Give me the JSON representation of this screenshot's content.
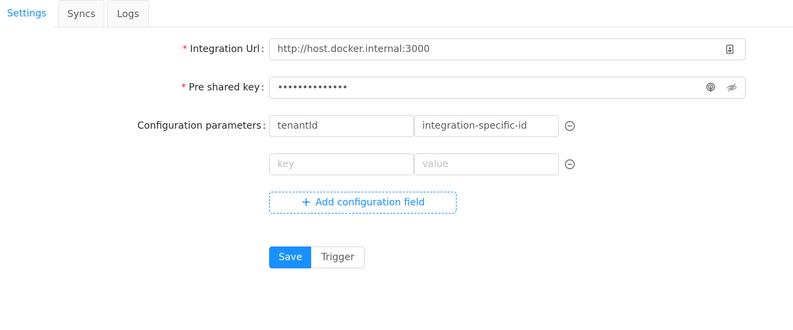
{
  "tabs": {
    "settings": "Settings",
    "syncs": "Syncs",
    "logs": "Logs",
    "active": "settings"
  },
  "form": {
    "integration_url": {
      "label": "Integration Url",
      "required": true,
      "value": "http://host.docker.internal:3000",
      "suffix_icon": "contacts-icon"
    },
    "pre_shared_key": {
      "label": "Pre shared key",
      "required": true,
      "value": "••••••••••••••",
      "suffix_icons": [
        "fingerprint-icon",
        "eye-invisible-icon"
      ]
    },
    "config_params": {
      "label": "Configuration parameters",
      "rows": [
        {
          "key": "tenantId",
          "value": "integration-specific-id",
          "key_placeholder": "key",
          "value_placeholder": "value"
        },
        {
          "key": "",
          "value": "",
          "key_placeholder": "key",
          "value_placeholder": "value"
        }
      ],
      "add_label": "Add configuration field"
    },
    "colon": ":",
    "required_mark": "*"
  },
  "actions": {
    "save": "Save",
    "trigger": "Trigger"
  },
  "colors": {
    "primary": "#1890ff",
    "required": "#f5222d",
    "border": "#d9d9d9"
  }
}
